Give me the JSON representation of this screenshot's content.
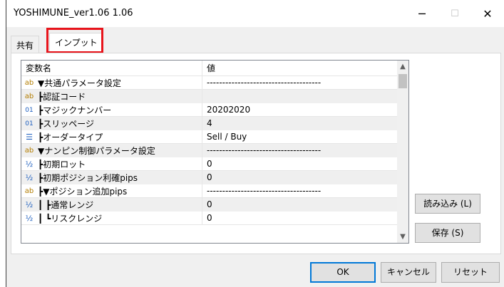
{
  "window": {
    "title": "YOSHIMUNE_ver1.06 1.06",
    "minimize_glyph": "─",
    "maximize_glyph": "☐",
    "close_glyph": "✕"
  },
  "tabs": [
    {
      "label": "共有",
      "active": false
    },
    {
      "label": "インプット",
      "active": true
    }
  ],
  "highlight_color": "#e8141b",
  "grid": {
    "columns": [
      "変数名",
      "値"
    ],
    "rows": [
      {
        "icon": "ab",
        "name": "▼共通パラメータ設定",
        "value": "-------------------------------------",
        "shaded": false
      },
      {
        "icon": "ab",
        "name": "┣認証コード",
        "value": "",
        "shaded": true
      },
      {
        "icon": "01",
        "name": "┣マジックナンバー",
        "value": "20202020",
        "shaded": false
      },
      {
        "icon": "01",
        "name": "┣スリッページ",
        "value": "4",
        "shaded": true
      },
      {
        "icon": "list",
        "name": "┣オーダータイプ",
        "value": "Sell / Buy",
        "shaded": false
      },
      {
        "icon": "ab",
        "name": "▼ナンピン制御パラメータ設定",
        "value": "-------------------------------------",
        "shaded": true
      },
      {
        "icon": "frac",
        "name": "┣初期ロット",
        "value": "0",
        "shaded": false
      },
      {
        "icon": "frac",
        "name": "┣初期ポジション利確pips",
        "value": "0",
        "shaded": true
      },
      {
        "icon": "ab",
        "name": "┣▼ポジション追加pips",
        "value": "-------------------------------------",
        "shaded": false
      },
      {
        "icon": "frac",
        "name": "┃ ┣通常レンジ",
        "value": "0",
        "shaded": true
      },
      {
        "icon": "frac",
        "name": "┃ ┗リスクレンジ",
        "value": "0",
        "shaded": false
      }
    ]
  },
  "buttons": {
    "load": "読み込み (L)",
    "save": "保存 (S)",
    "ok": "OK",
    "cancel": "キャンセル",
    "reset": "リセット"
  },
  "icons": {
    "ab": "ab",
    "01": "01",
    "frac": "½",
    "list": "☰"
  }
}
